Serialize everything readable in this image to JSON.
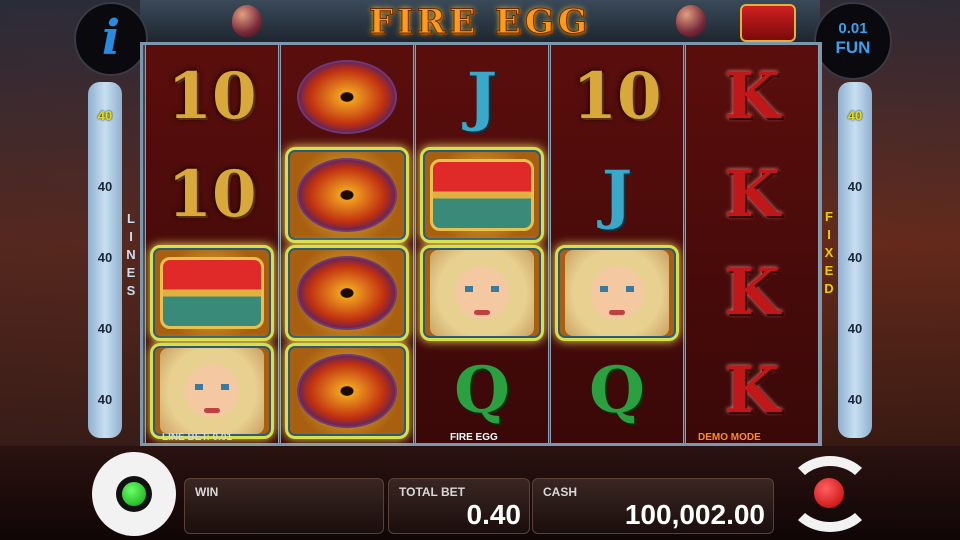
{
  "title": "FIRE EGG",
  "fun_badge": {
    "value": "0.01",
    "label": "FUN"
  },
  "reels": [
    [
      "10",
      "10",
      "chest",
      "maiden"
    ],
    [
      "dragon-eye",
      "dragon-eye",
      "dragon-eye",
      "dragon-eye"
    ],
    [
      "J",
      "chest",
      "maiden",
      "Q"
    ],
    [
      "10",
      "J",
      "maiden",
      "Q"
    ],
    [
      "K",
      "K",
      "K",
      "K"
    ]
  ],
  "winning_cells": [
    [
      0,
      2
    ],
    [
      0,
      3
    ],
    [
      1,
      1
    ],
    [
      1,
      2
    ],
    [
      1,
      3
    ],
    [
      2,
      1
    ],
    [
      2,
      2
    ],
    [
      3,
      2
    ]
  ],
  "lines_left": [
    "40",
    "40",
    "40",
    "40",
    "40"
  ],
  "lines_right": [
    "40",
    "40",
    "40",
    "40",
    "40"
  ],
  "left_vertical_label": "LINES",
  "right_vertical_label": "FIXED",
  "reel_footer": {
    "line_bet": "LINE BET: 0.01",
    "game_name": "FIRE EGG",
    "mode": "DEMO MODE"
  },
  "panels": {
    "win": {
      "label": "WIN",
      "value": ""
    },
    "total_bet": {
      "label": "TOTAL BET",
      "value": "0.40"
    },
    "cash": {
      "label": "CASH",
      "value": "100,002.00"
    }
  },
  "colors": {
    "highlight": "#d7e048",
    "active_line": "#e6e000",
    "fixed_label": "#e6d000"
  },
  "icons": {
    "info": "info-icon",
    "settings": "gear-icon",
    "spin": "spin-icon"
  }
}
